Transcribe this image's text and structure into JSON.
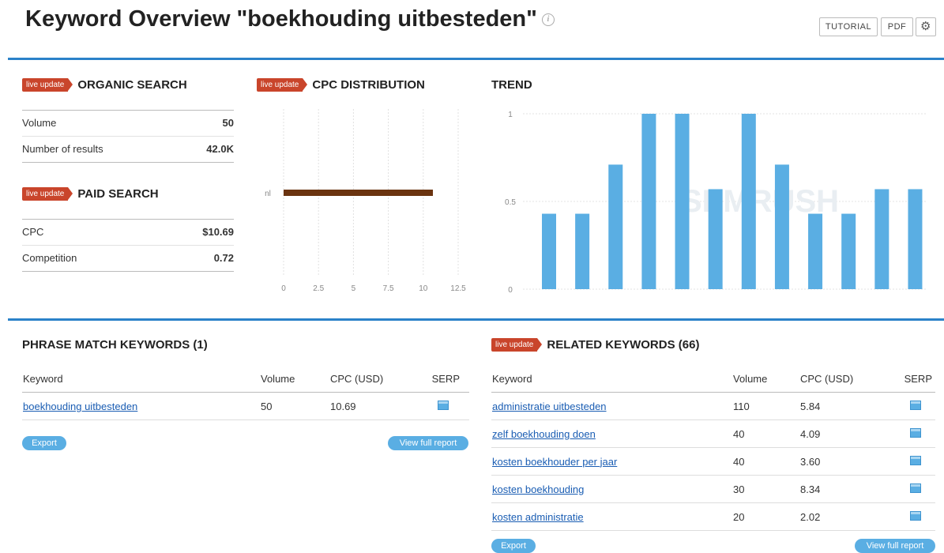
{
  "header": {
    "title": "Keyword Overview \"boekhouding uitbesteden\"",
    "tutorial_label": "TUTORIAL",
    "pdf_label": "PDF"
  },
  "badge_label": "live update",
  "organic": {
    "title": "ORGANIC SEARCH",
    "rows": [
      {
        "label": "Volume",
        "value": "50"
      },
      {
        "label": "Number of results",
        "value": "42.0K"
      }
    ]
  },
  "paid": {
    "title": "PAID SEARCH",
    "rows": [
      {
        "label": "CPC",
        "value": "$10.69"
      },
      {
        "label": "Competition",
        "value": "0.72"
      }
    ]
  },
  "cpc_distribution": {
    "title": "CPC DISTRIBUTION"
  },
  "trend": {
    "title": "TREND"
  },
  "chart_data": [
    {
      "type": "bar",
      "title": "CPC DISTRIBUTION",
      "orientation": "horizontal",
      "categories": [
        "nl"
      ],
      "values": [
        10.69
      ],
      "xlim": [
        0,
        12.5
      ],
      "xticks": [
        "0",
        "2.5",
        "5",
        "7.5",
        "10",
        "12.5"
      ],
      "color": "#6b3410"
    },
    {
      "type": "bar",
      "title": "TREND",
      "values": [
        0.43,
        0.43,
        0.71,
        1,
        1,
        0.57,
        1,
        0.71,
        0.43,
        0.43,
        0.57,
        0.57
      ],
      "ylim": [
        0,
        1
      ],
      "yticks": [
        "0",
        "0.5",
        "1"
      ],
      "color": "#5aaee3",
      "watermark": "SEMRUSH"
    }
  ],
  "phrase_match": {
    "title": "PHRASE MATCH KEYWORDS (1)",
    "headers": [
      "Keyword",
      "Volume",
      "CPC (USD)",
      "SERP"
    ],
    "rows": [
      {
        "keyword": "boekhouding uitbesteden",
        "volume": "50",
        "cpc": "10.69"
      }
    ],
    "export_label": "Export",
    "view_label": "View full report"
  },
  "related": {
    "title": "RELATED KEYWORDS (66)",
    "headers": [
      "Keyword",
      "Volume",
      "CPC (USD)",
      "SERP"
    ],
    "rows": [
      {
        "keyword": "administratie uitbesteden",
        "volume": "110",
        "cpc": "5.84"
      },
      {
        "keyword": "zelf boekhouding doen",
        "volume": "40",
        "cpc": "4.09"
      },
      {
        "keyword": "kosten boekhouder per jaar",
        "volume": "40",
        "cpc": "3.60"
      },
      {
        "keyword": "kosten boekhouding",
        "volume": "30",
        "cpc": "8.34"
      },
      {
        "keyword": "kosten administratie",
        "volume": "20",
        "cpc": "2.02"
      }
    ],
    "export_label": "Export",
    "view_label": "View full report"
  },
  "icons": {
    "info": "info-icon",
    "settings": "gear-icon",
    "serp": "serp-table-icon"
  }
}
